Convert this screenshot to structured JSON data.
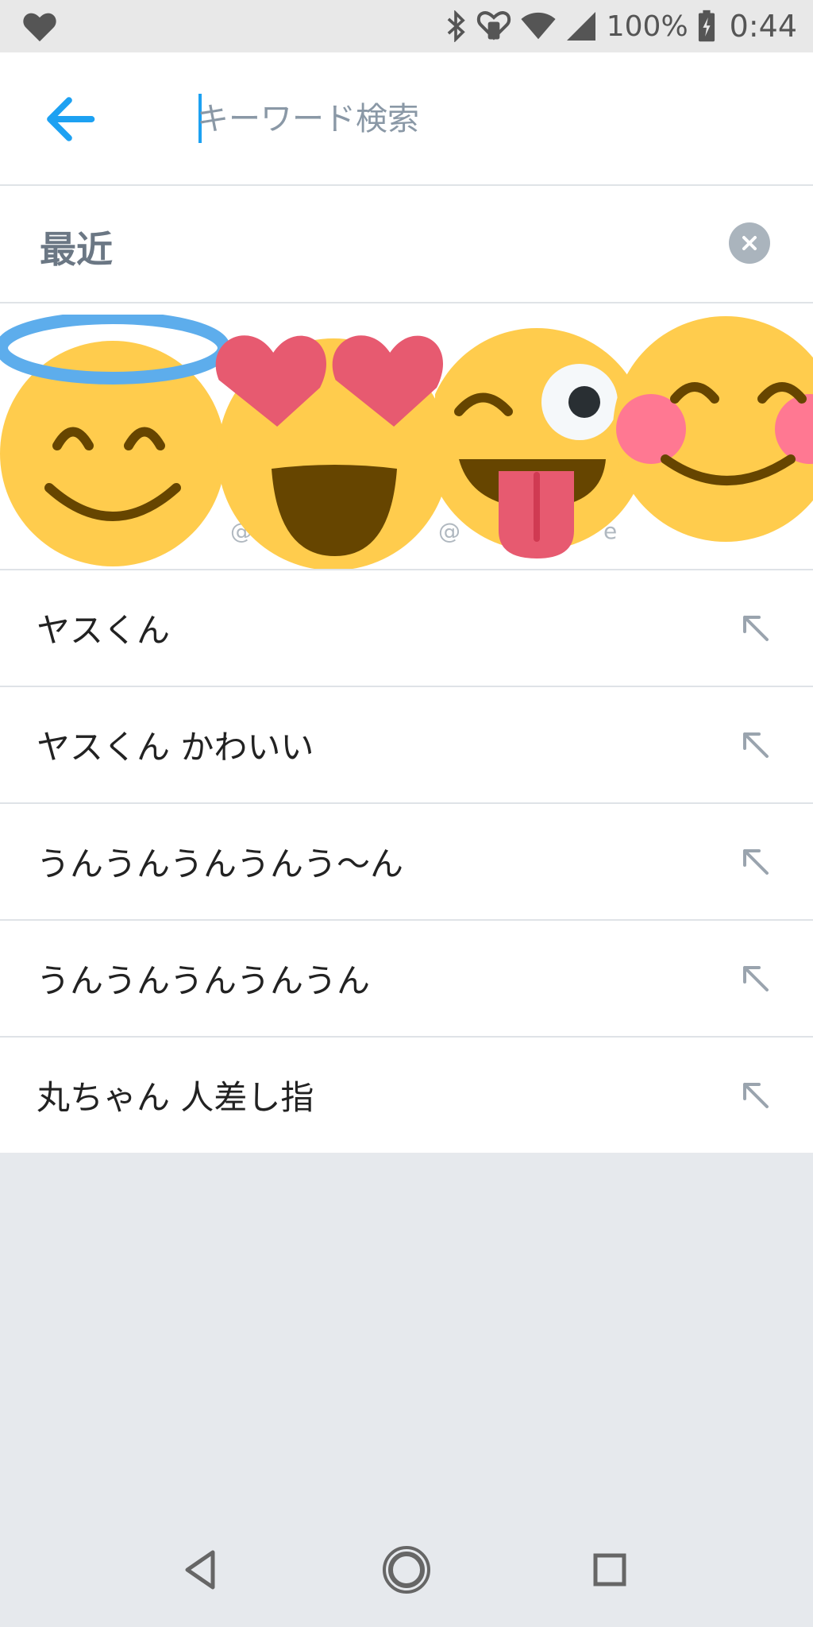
{
  "status_bar": {
    "battery": "100%",
    "time": "0:44",
    "icons": [
      "heart-icon",
      "bluetooth-icon",
      "heart-monitor-icon",
      "wifi-icon",
      "signal-icon",
      "battery-charging-icon"
    ]
  },
  "search": {
    "placeholder": "キーワード検索",
    "value": "",
    "back_icon": "arrow-left-icon",
    "accent": "#1da1f2"
  },
  "recent": {
    "title": "最近",
    "clear_icon": "close-circle-icon"
  },
  "recent_accounts": [
    {
      "emoji": "smiling-face-with-halo",
      "handle": "@"
    },
    {
      "emoji": "smiling-face-with-heart-eyes",
      "handle": "@"
    },
    {
      "emoji": "zany-winking-tongue-face",
      "handle": "@"
    },
    {
      "emoji": "smiling-face-with-blush",
      "handle": "e"
    }
  ],
  "recent_searches": [
    {
      "text": "ヤスくん",
      "icon": "arrow-up-left-icon"
    },
    {
      "text": "ヤスくん かわいい",
      "icon": "arrow-up-left-icon"
    },
    {
      "text": "うんうんうんうんう〜ん",
      "icon": "arrow-up-left-icon"
    },
    {
      "text": "うんうんうんうんうん",
      "icon": "arrow-up-left-icon"
    },
    {
      "text": "丸ちゃん 人差し指",
      "icon": "arrow-up-left-icon"
    }
  ],
  "nav": {
    "icons": [
      "back-triangle-icon",
      "home-circle-icon",
      "recents-square-icon"
    ]
  }
}
